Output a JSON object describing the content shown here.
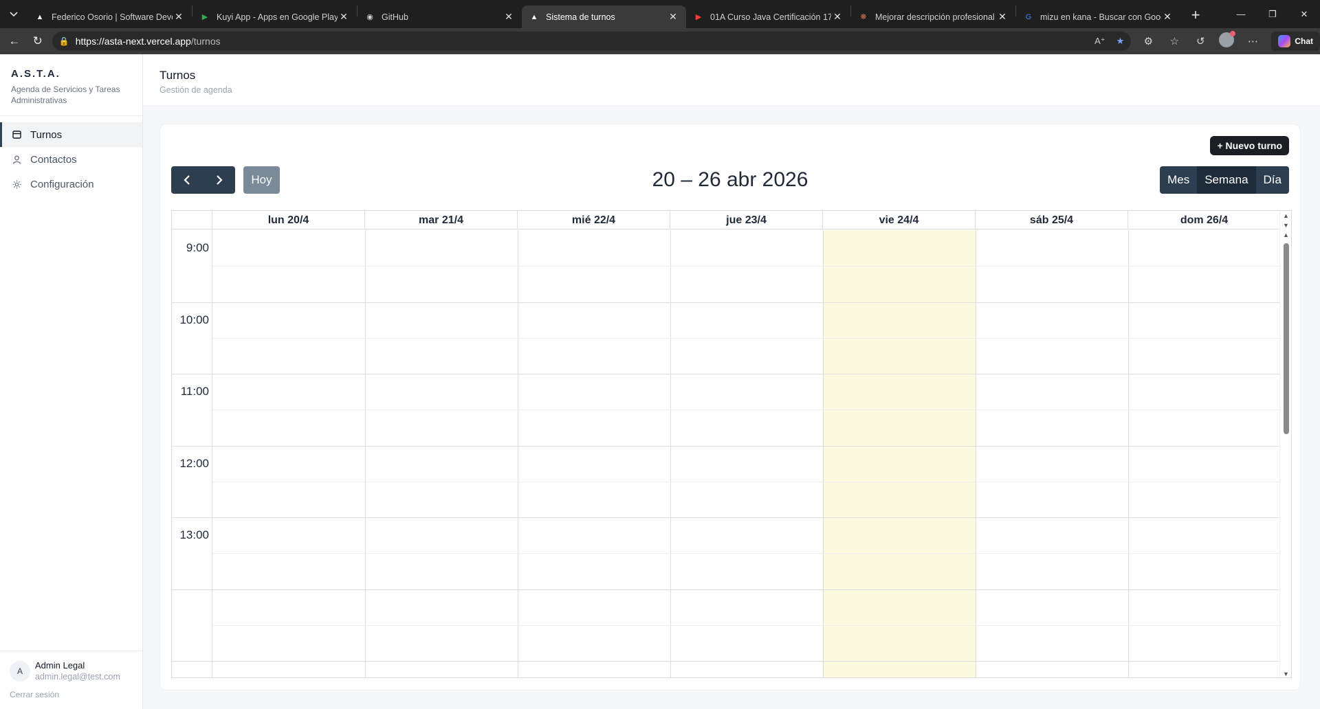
{
  "browser": {
    "tabs": [
      {
        "title": "Federico Osorio | Software Develo",
        "favicon": "triangle-icon",
        "active": false
      },
      {
        "title": "Kuyi App - Apps en Google Play",
        "favicon": "play-icon",
        "active": false
      },
      {
        "title": "GitHub",
        "favicon": "github-icon",
        "active": false
      },
      {
        "title": "Sistema de turnos",
        "favicon": "triangle-icon",
        "active": true
      },
      {
        "title": "01A Curso Java Certificación 17 - ",
        "favicon": "youtube-icon",
        "active": false
      },
      {
        "title": "Mejorar descripción profesional s",
        "favicon": "spark-icon",
        "active": false
      },
      {
        "title": "mizu en kana - Buscar con Google",
        "favicon": "google-icon",
        "active": false
      }
    ],
    "url_host": "https://asta-next.vercel.app",
    "url_path": "/turnos",
    "chat_label": "Chat"
  },
  "sidebar": {
    "brand_title": "A.S.T.A.",
    "brand_subtitle": "Agenda de Servicios y Tareas Administrativas",
    "items": [
      {
        "label": "Turnos",
        "icon": "calendar-icon",
        "active": true
      },
      {
        "label": "Contactos",
        "icon": "user-icon",
        "active": false
      },
      {
        "label": "Configuración",
        "icon": "sun-icon",
        "active": false
      }
    ],
    "user": {
      "initial": "A",
      "name": "Admin Legal",
      "email": "admin.legal@test.com"
    },
    "logout_label": "Cerrar sesión"
  },
  "header": {
    "title": "Turnos",
    "subtitle": "Gestión de agenda"
  },
  "calendar": {
    "new_button_label": "+ Nuevo turno",
    "prev_icon": "chevron-left-icon",
    "next_icon": "chevron-right-icon",
    "today_label": "Hoy",
    "range_title": "20 – 26 abr 2026",
    "views": [
      {
        "label": "Mes",
        "selected": false
      },
      {
        "label": "Semana",
        "selected": true
      },
      {
        "label": "Día",
        "selected": false
      }
    ],
    "days": [
      {
        "label": "lun 20/4",
        "today": false
      },
      {
        "label": "mar 21/4",
        "today": false
      },
      {
        "label": "mié 22/4",
        "today": false
      },
      {
        "label": "jue 23/4",
        "today": false
      },
      {
        "label": "vie 24/4",
        "today": true
      },
      {
        "label": "sáb 25/4",
        "today": false
      },
      {
        "label": "dom 26/4",
        "today": false
      }
    ],
    "hours": [
      "9:00",
      "10:00",
      "11:00",
      "12:00",
      "13:00"
    ],
    "today_color": "#fdf8e0",
    "accent_color": "#2c3e50"
  }
}
